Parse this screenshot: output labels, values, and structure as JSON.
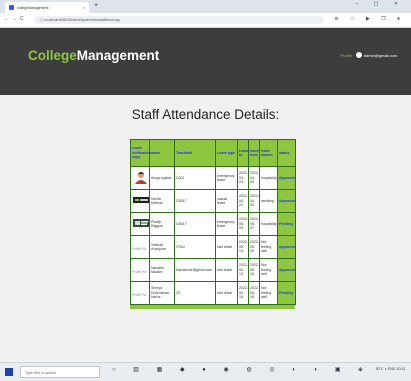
{
  "browser": {
    "tab_title": "collegeManagement",
    "tab_close": "×",
    "new_tab": "+",
    "window_controls": "–  ▢  ✕",
    "nav": {
      "back": "←",
      "forward": "→",
      "reload": "C",
      "info": "ⓘ"
    },
    "url": "localhost:8080/StudentSystem/viewstaffleave.jsp",
    "extensions": "⊘ ☆ ▶ ❐ ●"
  },
  "header": {
    "brand_part1": "College",
    "brand_part2": "Management",
    "user_prefix": "Profile",
    "user_email": "admin@gmail.com"
  },
  "page": {
    "title": "Staff Attendance Details:"
  },
  "table": {
    "headers": [
      "Leave Verification copy",
      "name",
      "TeacherId",
      "Leave type",
      "Leave to",
      "leave from",
      "leave reason",
      "status"
    ],
    "rows": [
      {
        "img": "avatar",
        "name": "Anuja zaykar",
        "teacher_id": "C001",
        "type": "emergency leave",
        "to": "2022-04-24",
        "from": "2022-04-25",
        "reason": "hospitality",
        "status": "Approved"
      },
      {
        "img": "doc",
        "name": "Kavita Mahore",
        "teacher_id": "CB017",
        "type": "casual leave",
        "to": "2022-04-21",
        "from": "2022-04-30",
        "reason": "wedding",
        "status": "Approved"
      },
      {
        "img": "card",
        "name": "Pradip Rajguru",
        "teacher_id": "CB017",
        "type": "emergency leave",
        "to": "2022-05-03",
        "from": "2022-05-07",
        "reason": "hospitality",
        "status": "Pending"
      },
      {
        "img": "broken",
        "broken_text": "Profile Pic",
        "name": "Vaishali Anaspure",
        "teacher_id": "IT002",
        "type": "sick leave",
        "to": "2022-05-13",
        "from": "2022-05-26",
        "reason": "Not feeling well",
        "status": "Approved"
      },
      {
        "img": "broken",
        "broken_text": "Profile Pic",
        "name": "Namdev Nadare",
        "teacher_id": "Namdevsir@gmail.com",
        "type": "sick leave",
        "to": "2022-05-13",
        "from": "2022-05-16",
        "reason": "Not feeling well",
        "status": "Approved"
      },
      {
        "img": "broken",
        "broken_text": "Profile Pic",
        "name": "Shreya Dharmaram Narhe",
        "teacher_id": "23",
        "type": "sick leave",
        "to": "2022-05-15",
        "from": "2022-05-16",
        "reason": "Not feeling well",
        "status": "Pending"
      }
    ]
  },
  "taskbar": {
    "search_placeholder": "Type here to search",
    "tray": "30°C  ∧  ENG  10:11"
  }
}
